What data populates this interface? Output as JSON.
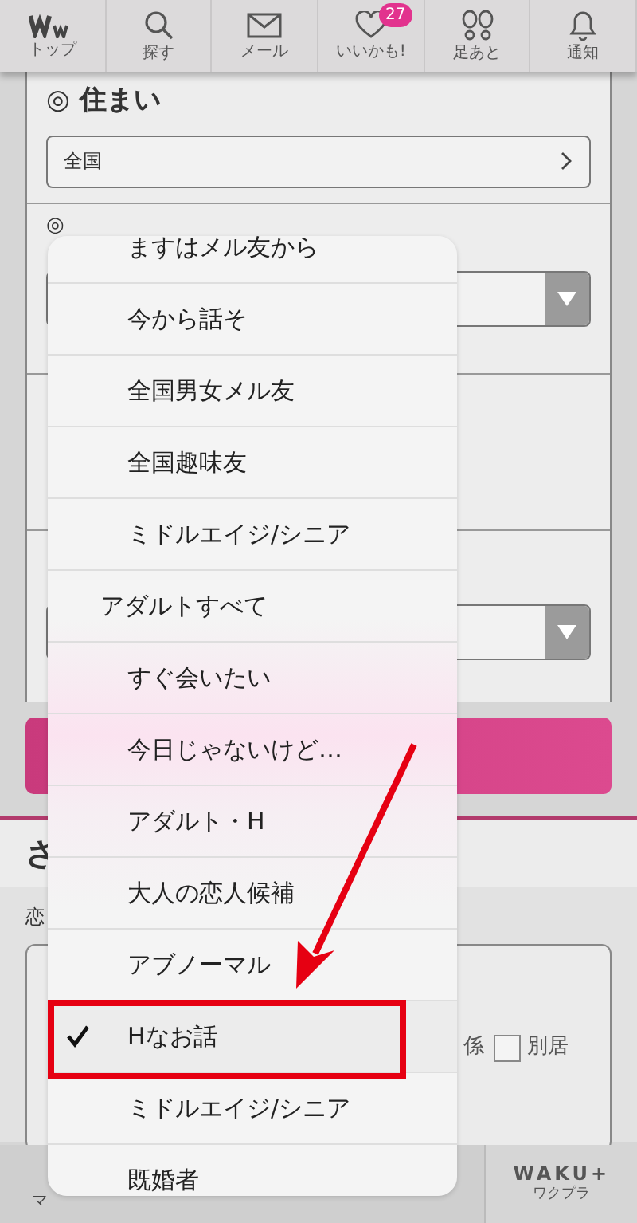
{
  "nav": [
    {
      "label": "トップ"
    },
    {
      "label": "探す"
    },
    {
      "label": "メール"
    },
    {
      "label": "いいかも!",
      "badge": "27"
    },
    {
      "label": "足あと"
    },
    {
      "label": "通知"
    }
  ],
  "form": {
    "residence": {
      "heading": "◎ 住まい",
      "value": "全国"
    },
    "age": {
      "heading": "◎"
    }
  },
  "section": {
    "heading": "さ",
    "label": "恋",
    "option_tail": "係",
    "checkbox": {
      "label": "別居",
      "checked": false
    }
  },
  "bottom_bar": {
    "left": "マ",
    "brand": "WAKU+",
    "brand_sub": "ワクプラ"
  },
  "picker": {
    "items": [
      {
        "kind": "option",
        "label": "ますはメル友から",
        "selected": false
      },
      {
        "kind": "option",
        "label": "今から話そ",
        "selected": false
      },
      {
        "kind": "option",
        "label": "全国男女メル友",
        "selected": false
      },
      {
        "kind": "option",
        "label": "全国趣味友",
        "selected": false
      },
      {
        "kind": "option",
        "label": "ミドルエイジ/シニア",
        "selected": false
      },
      {
        "kind": "group",
        "label": "アダルトすべて",
        "selected": false
      },
      {
        "kind": "option",
        "label": "すぐ会いたい",
        "selected": false
      },
      {
        "kind": "option",
        "label": "今日じゃないけど…",
        "selected": false
      },
      {
        "kind": "option",
        "label": "アダルト・H",
        "selected": false
      },
      {
        "kind": "option",
        "label": "大人の恋人候補",
        "selected": false
      },
      {
        "kind": "option",
        "label": "アブノーマル",
        "selected": false
      },
      {
        "kind": "option",
        "label": "Hなお話",
        "selected": true
      },
      {
        "kind": "option",
        "label": "ミドルエイジ/シニア",
        "selected": false
      },
      {
        "kind": "option",
        "label": "既婚者",
        "selected": false
      }
    ]
  }
}
